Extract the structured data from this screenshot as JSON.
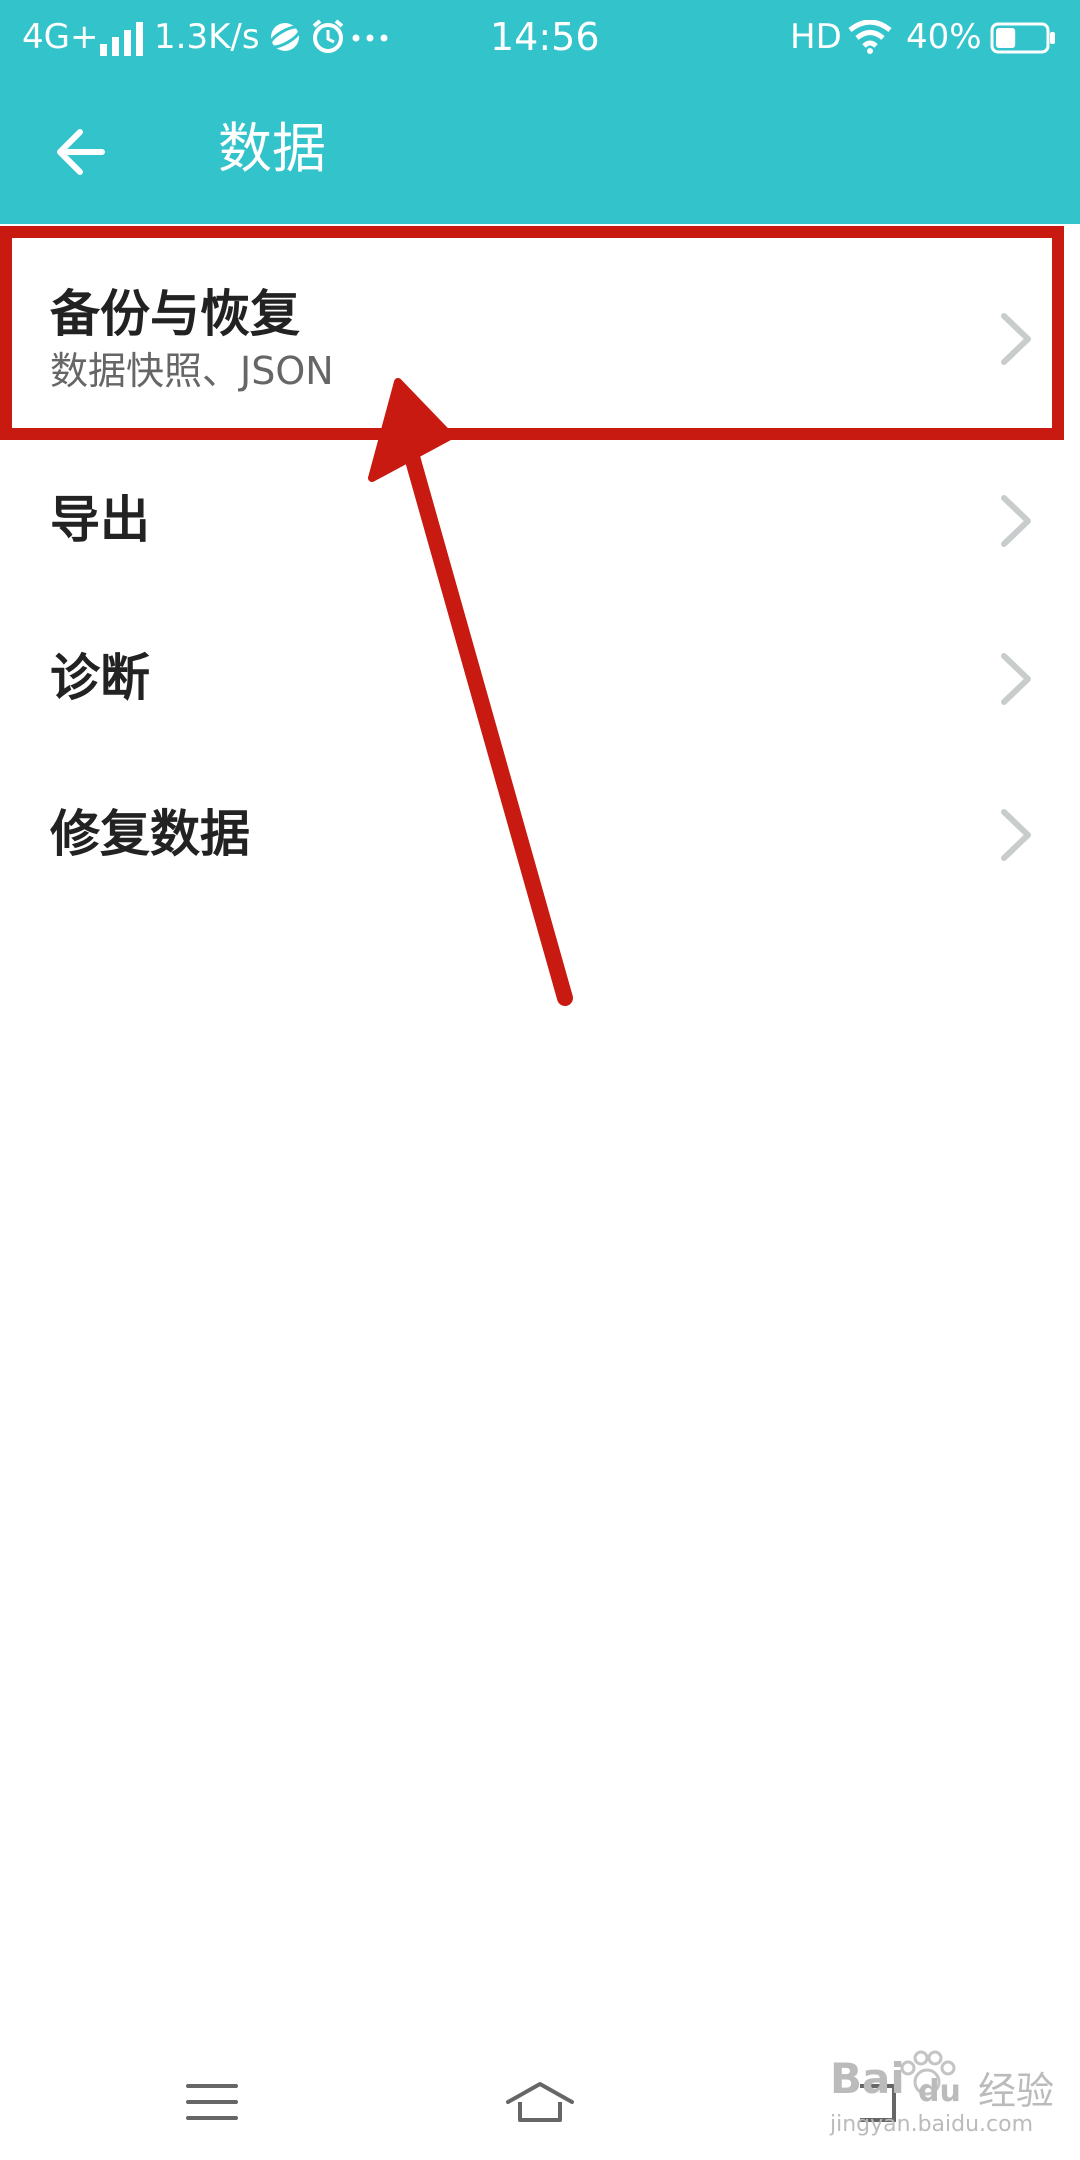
{
  "status_bar": {
    "network": "4G+",
    "speed": "1.3K/s",
    "time": "14:56",
    "hd": "HD",
    "battery_percent": "40%",
    "battery_level": 0.4,
    "icons": [
      "signal-icon",
      "browser-icon",
      "alarm-icon",
      "more-icon",
      "wifi-icon",
      "battery-icon"
    ]
  },
  "app_bar": {
    "title": "数据",
    "back_icon": "arrow-left-icon"
  },
  "menu": {
    "items": [
      {
        "title": "备份与恢复",
        "subtitle": "数据快照、JSON"
      },
      {
        "title": "导出"
      },
      {
        "title": "诊断"
      },
      {
        "title": "修复数据"
      }
    ],
    "chevron_icon": "chevron-right-icon"
  },
  "annotation": {
    "highlight_color": "#c81a10"
  },
  "nav_bar": {
    "icons": [
      "menu-icon",
      "home-icon",
      "back-icon"
    ]
  },
  "watermark": {
    "brand": "Bai",
    "brand_suffix": "du",
    "label": "经验",
    "url": "jingyan.baidu.com"
  },
  "colors": {
    "accent": "#33c3cb",
    "text_primary": "#222222",
    "text_secondary": "#666666",
    "chevron": "#c9cccc"
  }
}
